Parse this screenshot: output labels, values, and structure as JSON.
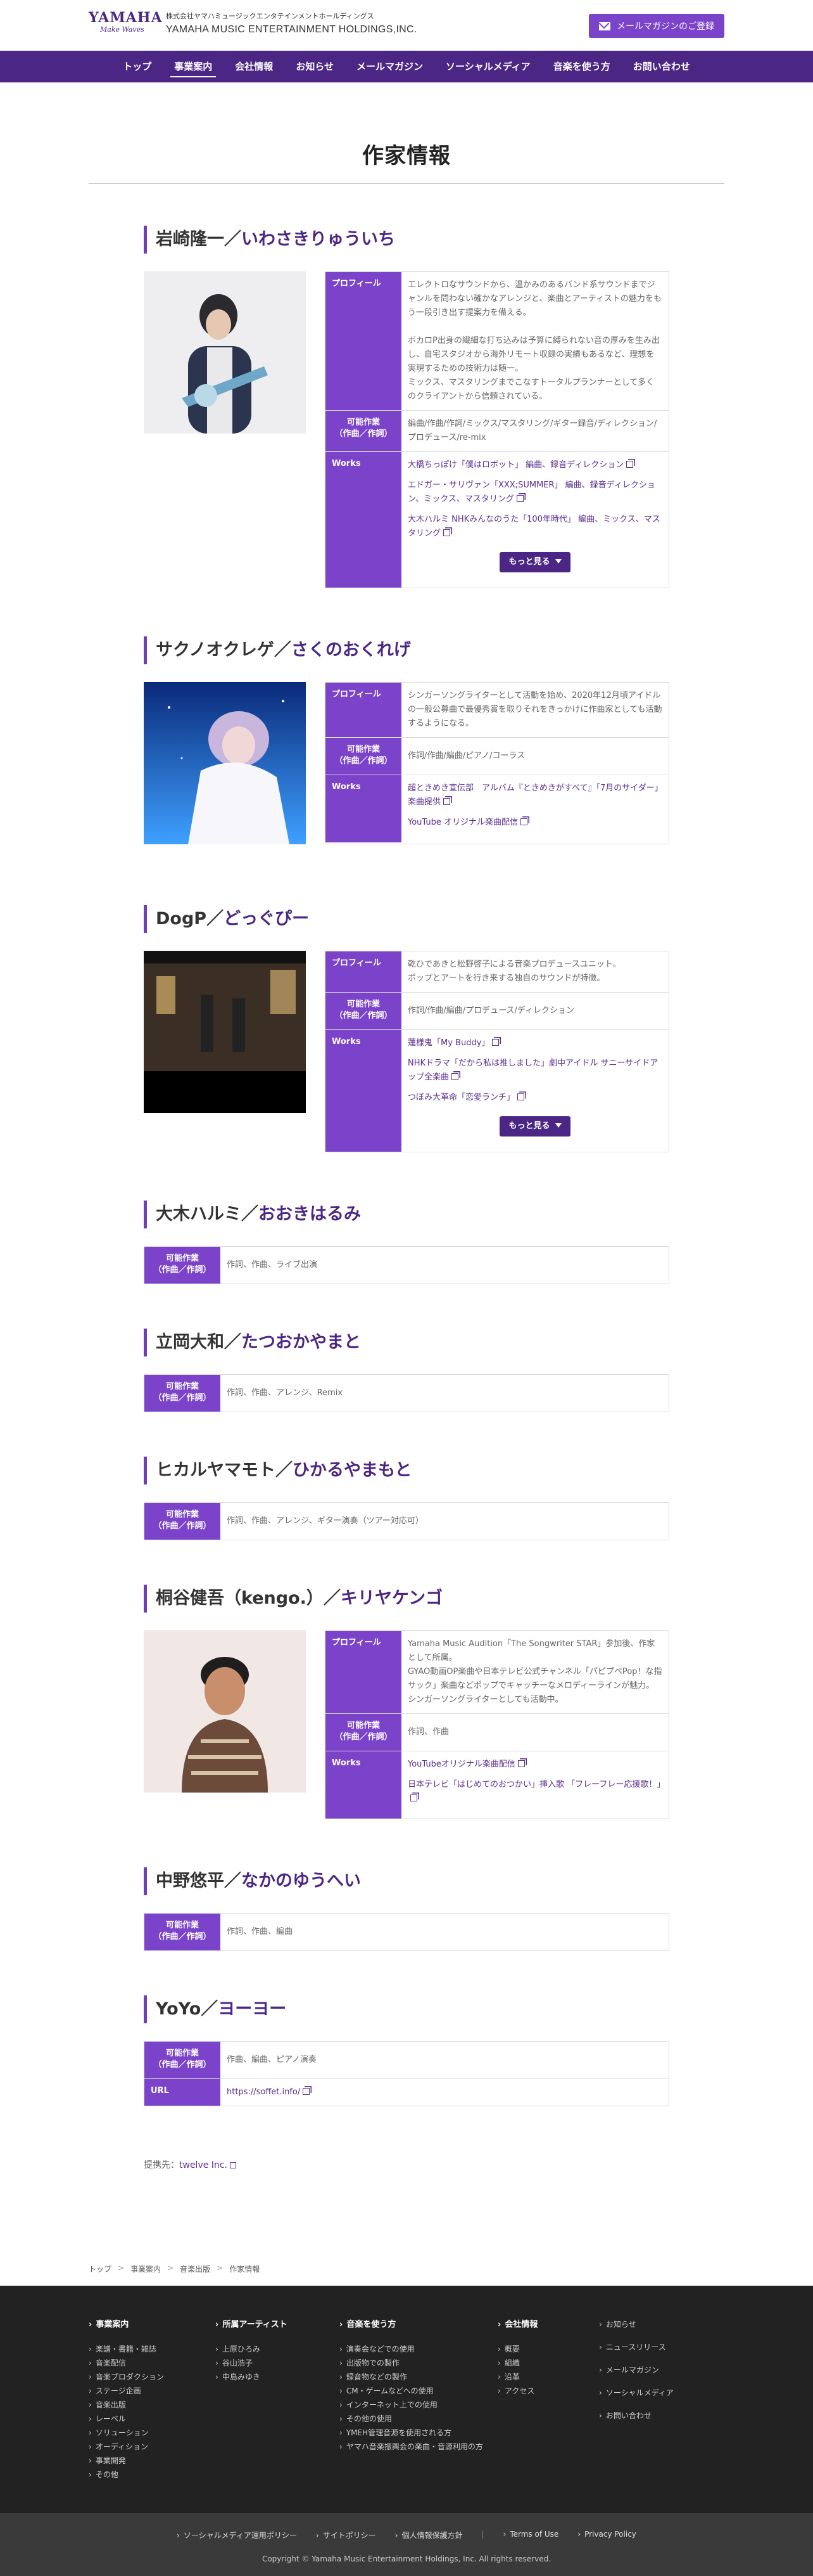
{
  "header": {
    "corp_jp": "株式会社ヤマハミュージックエンタテインメントホールディングス",
    "corp_en": "YAMAHA MUSIC ENTERTAINMENT HOLDINGS,INC.",
    "logo": "YAMAHA",
    "logo_sub": "Make Waves",
    "mail_button": "メールマガジンのご登録"
  },
  "nav": [
    "トップ",
    "事業案内",
    "会社情報",
    "お知らせ",
    "メールマガジン",
    "ソーシャルメディア",
    "音楽を使う方",
    "お問い合わせ"
  ],
  "page_title": "作家情報",
  "labels": {
    "profile": "プロフィール",
    "works_possible": "可能作業\n（作曲／作詞）",
    "works": "Works",
    "more": "もっと見る",
    "url": "URL"
  },
  "artists": [
    {
      "name": "岩崎隆一",
      "kana": "いわさきりゅういち",
      "profile": [
        "エレクトロなサウンドから、温かみのあるバンド系サウンドまでジャンルを問わない確かなアレンジと、楽曲とアーティストの魅力をもう一段引き出す提案力を備える。",
        "ボカロP出身の繊細な打ち込みは予算に縛られない音の厚みを生み出し、自宅スタジオから海外リモート収録の実績もあるなど、理想を実現するための技術力は随一。\nミックス、マスタリングまでこなすトータルプランナーとして多くのクライアントから信頼されている。"
      ],
      "possible": "編曲/作曲/作詞/ミックス/マスタリング/ギター録音/ディレクション/プロデュース/re-mix",
      "works": [
        "大橋ちっぽけ「僕はロボット」 編曲、録音ディレクション",
        "エドガー・サリヴァン「XXX;SUMMER」 編曲、録音ディレクション、ミックス、マスタリング",
        "大木ハルミ NHKみんなのうた「100年時代」 編曲、ミックス、マスタリング"
      ]
    },
    {
      "name": "サクノオクレゲ",
      "kana": "さくのおくれげ",
      "profile": [
        "シンガーソングライターとして活動を始め、2020年12月頃アイドルの一般公募曲で最優秀賞を取りそれをきっかけに作曲家としても活動するようになる。"
      ],
      "possible": "作詞/作曲/編曲/ピアノ/コーラス",
      "works": [
        "超ときめき宣伝部　アルバム『ときめきがすべて』「7月のサイダー」楽曲提供",
        "YouTube オリジナル楽曲配信"
      ]
    },
    {
      "name": "DogP",
      "kana": "どっぐぴー",
      "profile": [
        "乾ひであきと松野啓子による音楽プロデュースユニット。\nポップとアートを行き来する独自のサウンドが特徴。"
      ],
      "possible": "作詞/作曲/編曲/プロデュース/ディレクション",
      "works": [
        "蓮様鬼「My Buddy」",
        "NHKドラマ「だから私は推しました」劇中アイドル サニーサイドアップ全楽曲",
        "つぼみ大革命「恋愛ランチ」"
      ]
    },
    {
      "name": "大木ハルミ",
      "kana": "おおきはるみ",
      "possible": "作詞、作曲、ライブ出演"
    },
    {
      "name": "立岡大和",
      "kana": "たつおかやまと",
      "possible": "作詞、作曲、アレンジ、Remix"
    },
    {
      "name": "ヒカルヤマモト",
      "kana": "ひかるやまもと",
      "possible": "作詞、作曲、アレンジ、ギター演奏（ツアー対応可）"
    },
    {
      "name": "桐谷健吾（kengo.）",
      "kana": "キリヤケンゴ",
      "profile": [
        "Yamaha Music Audition「The Songwriter STAR」参加後、作家として所属。\nGYAO動画OP楽曲や日本テレビ公式チャンネル「パピプペPop！な指サック」楽曲などポップでキャッチーなメロディーラインが魅力。シンガーソングライターとしても活動中。"
      ],
      "possible": "作詞、作曲",
      "works": [
        "YouTubeオリジナル楽曲配信",
        "日本テレビ「はじめてのおつかい」挿入歌 「フレーフレー応援歌！」"
      ]
    },
    {
      "name": "中野悠平",
      "kana": "なかのゆうへい",
      "possible": "作詞、作曲、編曲"
    },
    {
      "name": "YoYo",
      "kana": "ヨーヨー",
      "possible": "作曲、編曲、ピアノ演奏",
      "url": "https://soffet.info/"
    }
  ],
  "credit_label": "提携先：",
  "credit_link": "twelve Inc.",
  "breadcrumb": [
    "トップ",
    "事業案内",
    "音楽出版",
    "作家情報"
  ],
  "footer": {
    "cols": [
      {
        "head": "事業案内",
        "items": [
          "楽譜・書籍・雑誌",
          "音楽配信",
          "音楽プロダクション",
          "ステージ企画",
          "音楽出版",
          "レーベル",
          "ソリューション",
          "オーディション",
          "事業開発",
          "その他"
        ]
      },
      {
        "head": "所属アーティスト",
        "items": [
          "上原ひろみ",
          "谷山浩子",
          "中島みゆき"
        ]
      },
      {
        "head": "音楽を使う方",
        "items": [
          "演奏会などでの使用",
          "出版物での製作",
          "録音物などの製作",
          "CM・ゲームなどへの使用",
          "インターネット上での使用",
          "その他の使用",
          "YMEH管理音源を使用される方",
          "ヤマハ音楽振興会の楽曲・音源利用の方"
        ]
      },
      {
        "head": "会社情報",
        "items": [
          "概要",
          "組織",
          "沿革",
          "アクセス"
        ]
      },
      {
        "head": "",
        "items": [
          "お知らせ",
          "ニュースリリース",
          "メールマガジン",
          "ソーシャルメディア",
          "お問い合わせ"
        ]
      }
    ],
    "links": [
      "ソーシャルメディア運用ポリシー",
      "サイトポリシー",
      "個人情報保護方針",
      "Terms of Use",
      "Privacy Policy"
    ],
    "copyright": "Copyright © Yamaha Music Entertainment Holdings, Inc. All rights reserved."
  }
}
